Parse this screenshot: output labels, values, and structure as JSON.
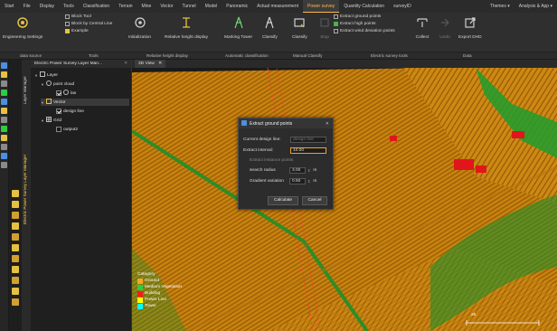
{
  "menu": {
    "items": [
      "Start",
      "File",
      "Display",
      "Tools",
      "Classification",
      "Terrain",
      "Mine",
      "Vector",
      "Tunnel",
      "Model",
      "Panoramic",
      "Actual measurement",
      "Power survey",
      "Quantity Calculation",
      "surveyID"
    ],
    "right": [
      "Themes ▾",
      "Analysis & App ▾"
    ]
  },
  "ribbon": {
    "engineering_settings": "Engineering Settings",
    "block_tool": "Block Tool",
    "block_central_line": "Block by Central Line",
    "example": "Example",
    "initialization": "Initialization",
    "relative_height_display": "Relative height display",
    "marking_tower": "Marking Tower",
    "classify1": "Classify",
    "classify2": "Classify",
    "stop": "Stop",
    "extract_ground": "Extract ground points",
    "extract_high": "Extract high points",
    "extract_wind": "Extract wind deviation points",
    "collect": "Collect",
    "undo": "Undo",
    "export_dhd": "Export DHD"
  },
  "groups": {
    "data_source": "data source",
    "tools": "Tools",
    "relative_height": "Relative height display",
    "auto_class": "Automatic classification",
    "manual_class": "Manual Classify",
    "elec_tools": "Electric survey tools",
    "data": "Data"
  },
  "vtabs": {
    "layer_manager": "Layer Manager",
    "power_manager": "Electric Power Survey Layer Manager"
  },
  "panel": {
    "title": "Electric Power Survey Layer Man...",
    "close": "✕",
    "tree": {
      "layer": "Layer",
      "point_cloud": "point cloud",
      "las": "las",
      "vector": "Vector",
      "design_line": "design line",
      "grid": "Grid",
      "output2": "output2"
    }
  },
  "view": {
    "tab": "3D View",
    "tab_close": "✕"
  },
  "dialog": {
    "title": "Extract ground points",
    "close": "✕",
    "design_line_label": "Current design line:",
    "design_line_value": "design line",
    "interval_label": "Extract interval:",
    "interval_value": "10.00",
    "instance_label": "Extract instance points",
    "radius_label": "search radius",
    "radius_value": "3.00",
    "radius_unit": "m",
    "gradient_label": "Gradient variation",
    "gradient_value": "0.50",
    "gradient_unit": "m",
    "calculate": "Calculate",
    "cancel": "Cancel"
  },
  "legend": {
    "title": "Category",
    "items": [
      {
        "label": "Ground",
        "color": "#f5a623"
      },
      {
        "label": "Medium Vegetation",
        "color": "#2ecc40"
      },
      {
        "label": "Building",
        "color": "#ff1a1a"
      },
      {
        "label": "Power Line",
        "color": "#ffff00"
      },
      {
        "label": "Tower",
        "color": "#00ffff"
      }
    ]
  },
  "scale": "25",
  "colors": {
    "accent": "#ffb74a",
    "ground": "#d98a12",
    "vegetation": "#1f9d2e",
    "building": "#e0161b"
  }
}
